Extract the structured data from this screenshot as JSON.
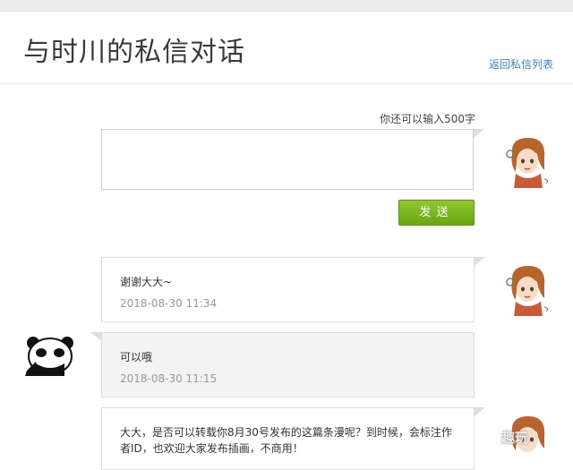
{
  "header": {
    "title": "与时川的私信对话",
    "back_label": "返回私信列表"
  },
  "compose": {
    "counter": "你还可以输入500字",
    "value": "",
    "send_label": "发送"
  },
  "messages": [
    {
      "side": "right",
      "text": "谢谢大大~",
      "time": "2018-08-30 11:34"
    },
    {
      "side": "left",
      "text": "可以哦",
      "time": "2018-08-30 11:15"
    },
    {
      "side": "right",
      "text": "大大，是否可以转载你8月30号发布的这篇条漫呢？到时候，会标注作者ID，也欢迎大家发布插画，不商用！",
      "time": ""
    }
  ],
  "watermark": "趣玩"
}
